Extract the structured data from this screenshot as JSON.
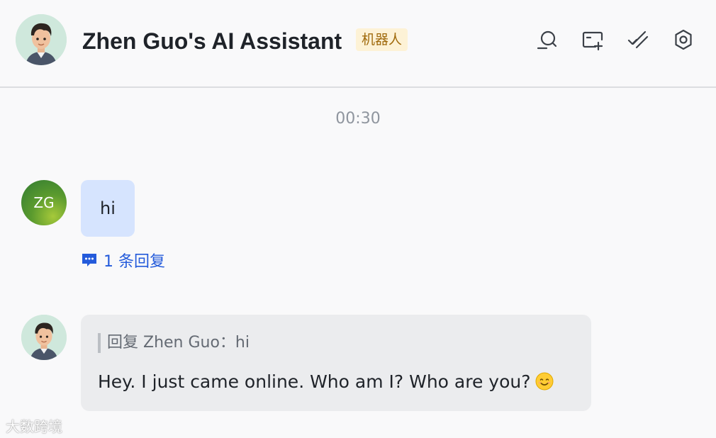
{
  "header": {
    "title": "Zhen Guo's AI Assistant",
    "badge": "机器人",
    "icons": [
      "search-icon",
      "add-card-icon",
      "checkmarks-icon",
      "gear-icon"
    ]
  },
  "chat": {
    "timestamp": "00:30",
    "messages": [
      {
        "sender_initials": "ZG",
        "text": "hi",
        "reply_count_label": "1 条回复"
      },
      {
        "quote": "回复 Zhen Guo：hi",
        "text": "Hey. I just came online. Who am I? Who are you?",
        "emoji": "smiling-face-emoji"
      }
    ]
  },
  "watermark": "大数跨境",
  "colors": {
    "user_bubble": "#d6e4fe",
    "bot_bubble": "#ebecee",
    "link": "#245bdb",
    "badge_bg": "#fdf2d6",
    "badge_text": "#a06a0c"
  }
}
